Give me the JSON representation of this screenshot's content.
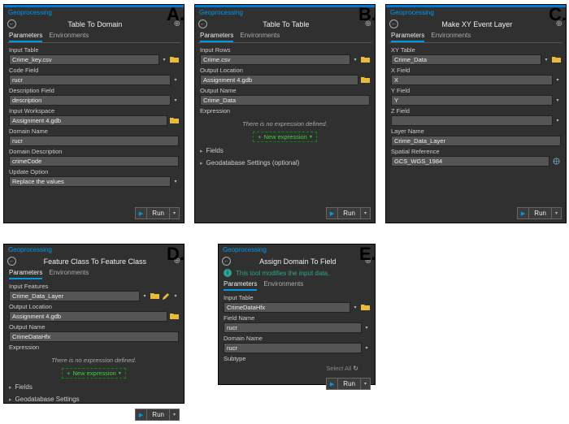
{
  "common": {
    "app": "Geoprocessing",
    "tabs": {
      "parameters": "Parameters",
      "environments": "Environments"
    },
    "run": "Run",
    "newExpr": "New expression",
    "noExpr": "There is no expression defined.",
    "fields": "Fields",
    "geodbOpt": "Geodatabase Settings (optional)",
    "geodb": "Geodatabase Settings",
    "selectAll": "Select All"
  },
  "panelA": {
    "title": "Table To Domain",
    "f": {
      "inputTable_l": "Input Table",
      "inputTable": "Crime_key.csv",
      "codeField_l": "Code Field",
      "codeField": "rucr",
      "descField_l": "Description Field",
      "descField": "description",
      "inputWs_l": "Input Workspace",
      "inputWs": "Assignment 4.gdb",
      "domName_l": "Domain Name",
      "domName": "rucr",
      "domDesc_l": "Domain Description",
      "domDesc": "crimeCode",
      "upd_l": "Update Option",
      "upd": "Replace the values"
    }
  },
  "panelB": {
    "title": "Table To Table",
    "f": {
      "inRows_l": "Input Rows",
      "inRows": "Crime.csv",
      "outLoc_l": "Output Location",
      "outLoc": "Assignment 4.gdb",
      "outName_l": "Output Name",
      "outName": "Crime_Data",
      "expr_l": "Expression"
    }
  },
  "panelC": {
    "title": "Make XY Event Layer",
    "f": {
      "xyTable_l": "XY Table",
      "xyTable": "Crime_Data",
      "xField_l": "X Field",
      "xField": "X",
      "yField_l": "Y Field",
      "yField": "Y",
      "zField_l": "Z Field",
      "zField": "",
      "layer_l": "Layer Name",
      "layer": "Crime_Data_Layer",
      "sref_l": "Spatial Reference",
      "sref": "GCS_WGS_1984"
    }
  },
  "panelD": {
    "title": "Feature Class To Feature Class",
    "f": {
      "inFeat_l": "Input Features",
      "inFeat": "Crime_Data_Layer",
      "outLoc_l": "Output Location",
      "outLoc": "Assignment 4.gdb",
      "outName_l": "Output Name",
      "outName": "CrimeDataHfx",
      "expr_l": "Expression"
    }
  },
  "panelE": {
    "title": "Assign Domain To Field",
    "info": "This tool modifies the input data.",
    "f": {
      "inTable_l": "Input Table",
      "inTable": "CrimeDataHfx",
      "fName_l": "Field Name",
      "fName": "rucr",
      "dName_l": "Domain Name",
      "dName": "rucr",
      "sub_l": "Subtype",
      "sub": ""
    }
  },
  "labels": {
    "A": "A.",
    "B": "B.",
    "C": "C.",
    "D": "D.",
    "E": "E."
  }
}
